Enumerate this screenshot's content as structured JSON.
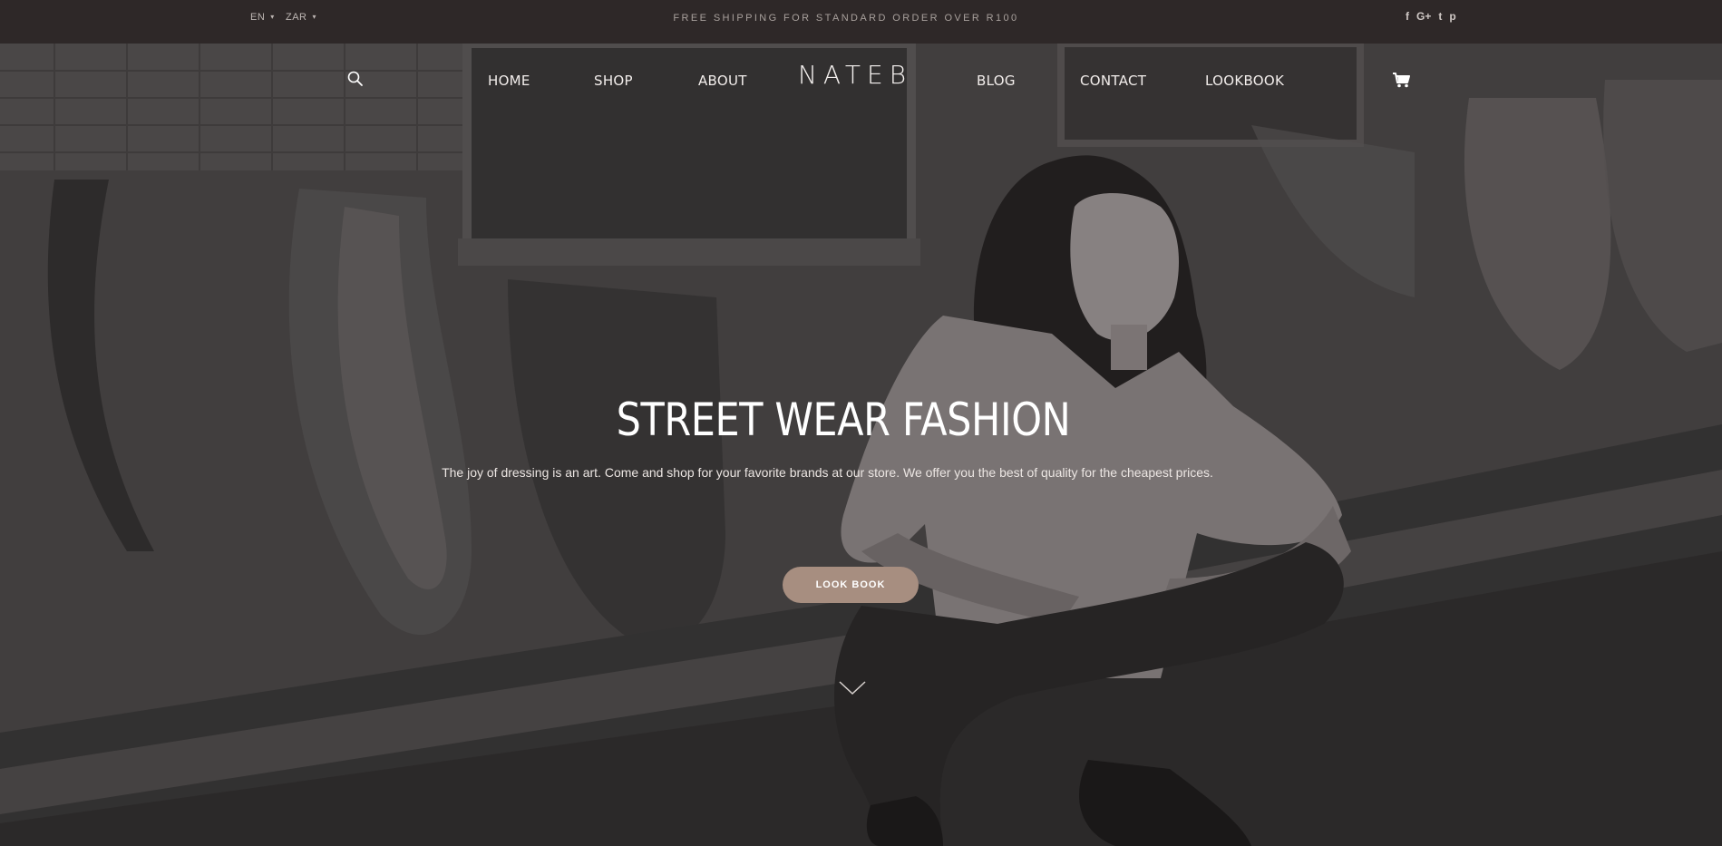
{
  "topbar": {
    "language": "EN",
    "currency": "ZAR",
    "shipping_notice": "FREE SHIPPING FOR STANDARD ORDER OVER R100",
    "social": [
      {
        "icon": "facebook-icon",
        "glyph": "f"
      },
      {
        "icon": "google-plus-icon",
        "glyph": "G+"
      },
      {
        "icon": "twitter-icon",
        "glyph": "t"
      },
      {
        "icon": "pinterest-icon",
        "glyph": "p"
      }
    ]
  },
  "nav": {
    "logo": "NATEB",
    "left_items": [
      "HOME",
      "SHOP",
      "ABOUT"
    ],
    "right_items": [
      "BLOG",
      "CONTACT",
      "LOOKBOOK"
    ],
    "icons": {
      "search": "search-icon",
      "cart": "cart-icon"
    }
  },
  "hero": {
    "title": "STREET WEAR FASHION",
    "subtitle": "The joy of dressing is an art. Come and shop for your favorite brands at our store. We offer you the best of quality for the cheapest prices.",
    "cta_label": "LOOK BOOK",
    "scroll_icon": "chevron-down-icon"
  },
  "colors": {
    "topbar_bg": "#2e2828",
    "button_bg": "#a78e80",
    "text_light": "#ffffff"
  }
}
